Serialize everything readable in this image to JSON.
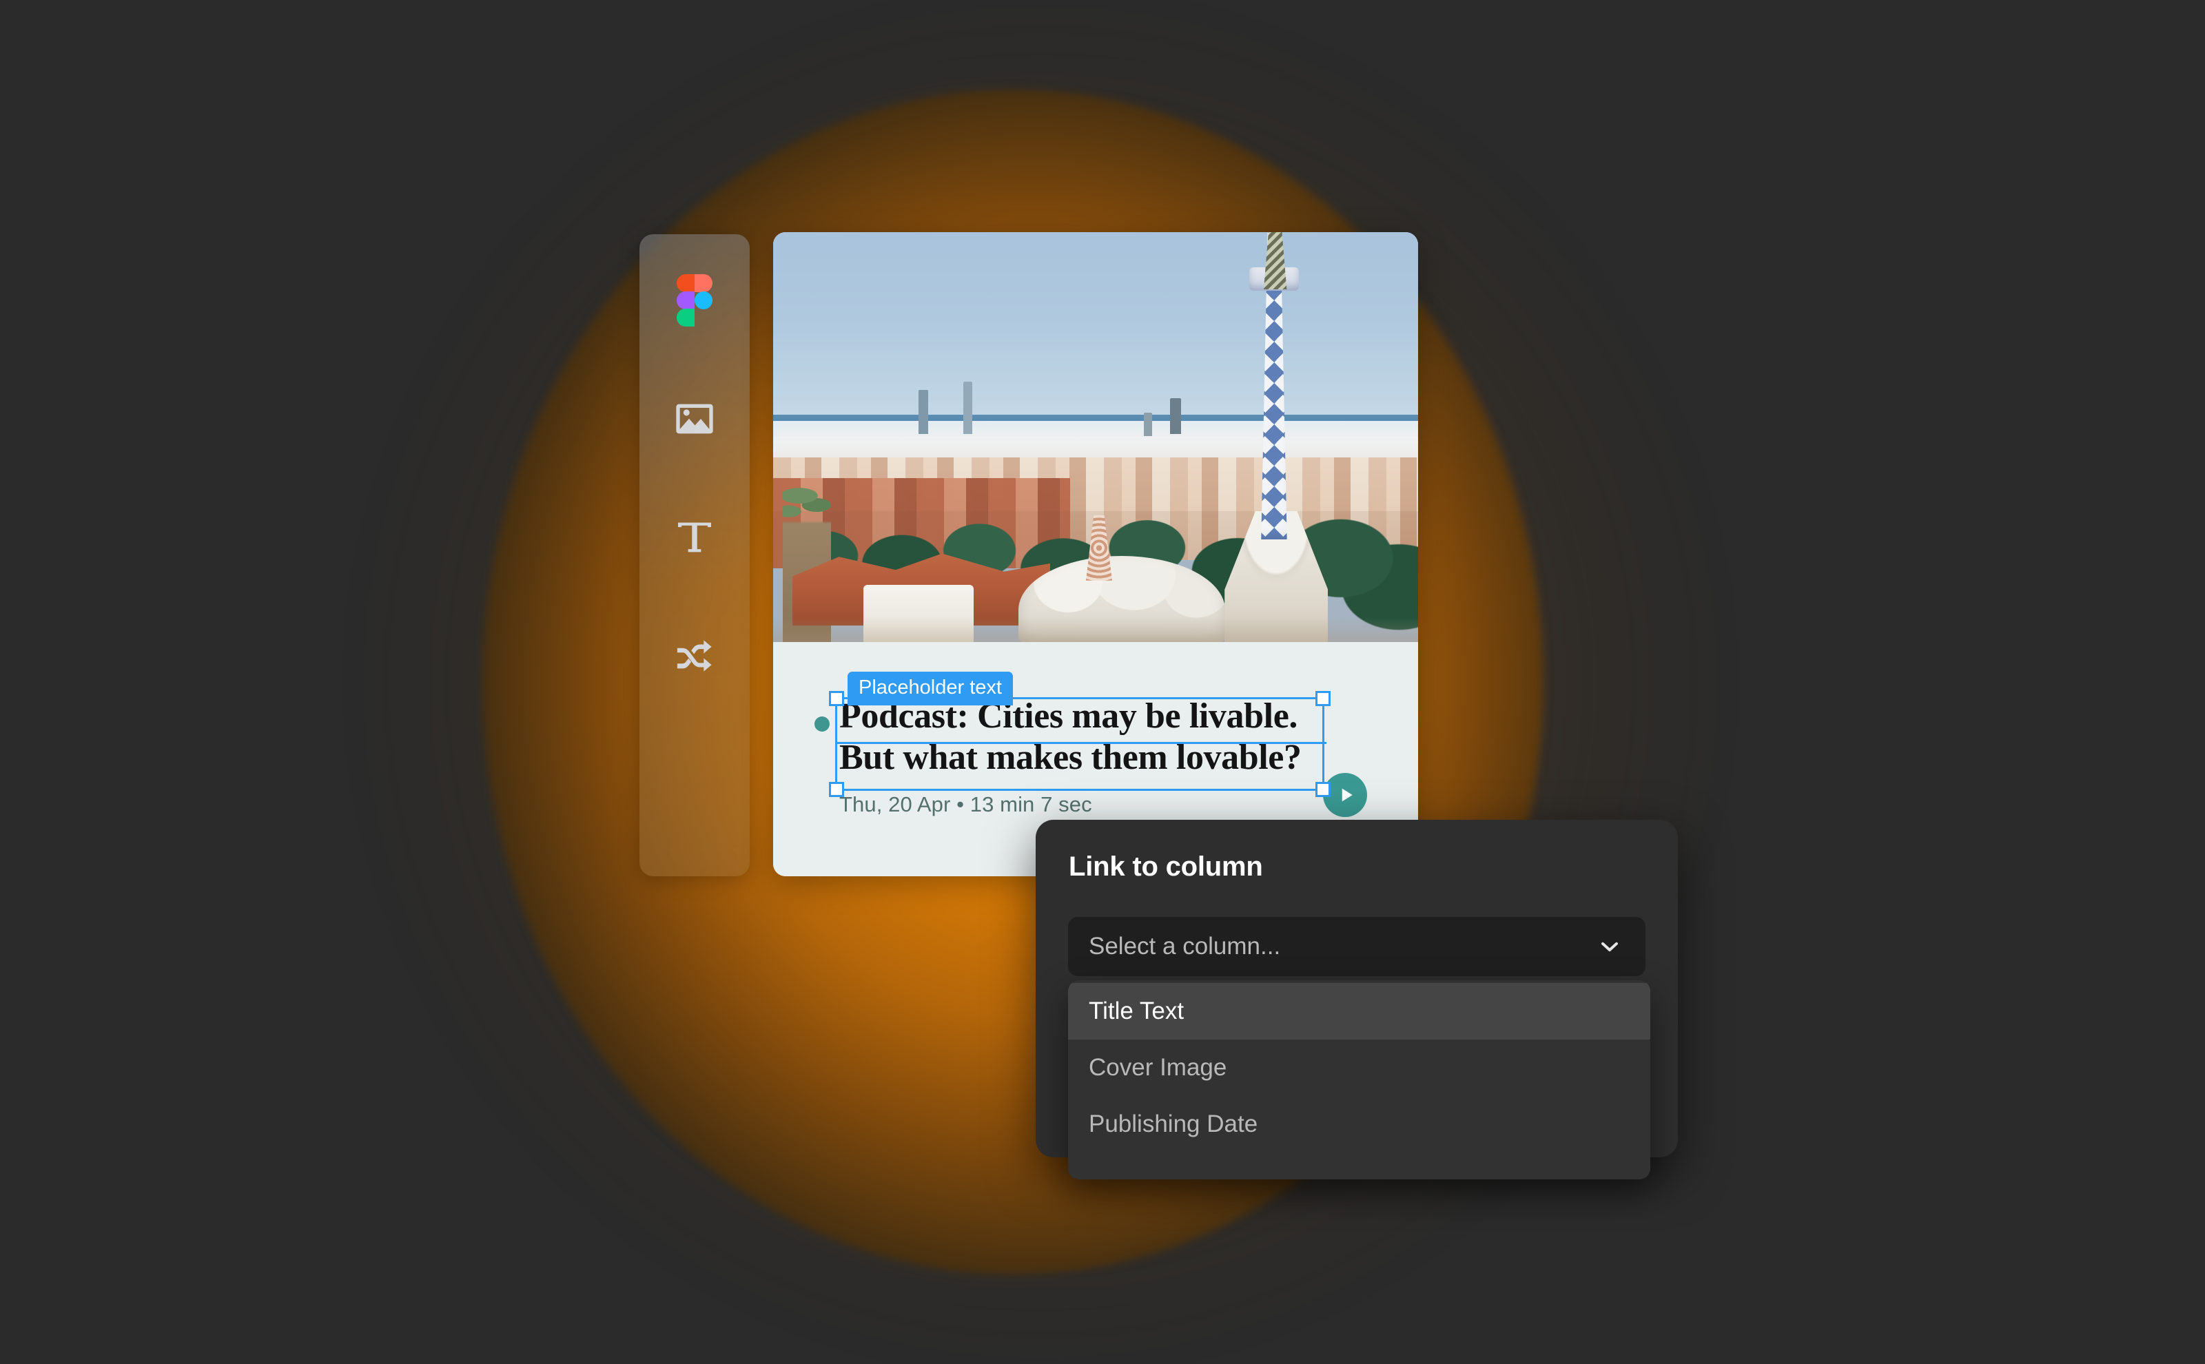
{
  "canvas": {
    "background_color": "#2b2b2b",
    "glow_color": "#d97c07"
  },
  "toolbar": {
    "name": "figma-plugin-toolbar",
    "items": [
      {
        "icon": "figma-logo-icon",
        "label": "Figma"
      },
      {
        "icon": "image-icon",
        "label": "Image"
      },
      {
        "icon": "text-icon",
        "label": "Text"
      },
      {
        "icon": "shuffle-icon",
        "label": "Shuffle"
      }
    ]
  },
  "card": {
    "title_line1": "Podcast: Cities may be livable.",
    "title_line2": "But what makes them lovable?",
    "meta": "Thu, 20 Apr • 13 min 7 sec",
    "cover_image_alt": "Barcelona cityscape seen from Park Güell with Gaudí mosaic spire",
    "play_button_label": "Play",
    "accent_color": "#3a9a93",
    "background_color": "#e9efee"
  },
  "selection": {
    "badge_label": "Placeholder text",
    "badge_color": "#2f9bf2"
  },
  "dialog": {
    "title": "Link to column",
    "select": {
      "value": "Select a column...",
      "chevron_icon": "chevron-down-icon"
    },
    "options": [
      {
        "label": "Title Text",
        "selected": true
      },
      {
        "label": "Cover Image",
        "selected": false
      },
      {
        "label": "Publishing Date",
        "selected": false
      }
    ]
  }
}
